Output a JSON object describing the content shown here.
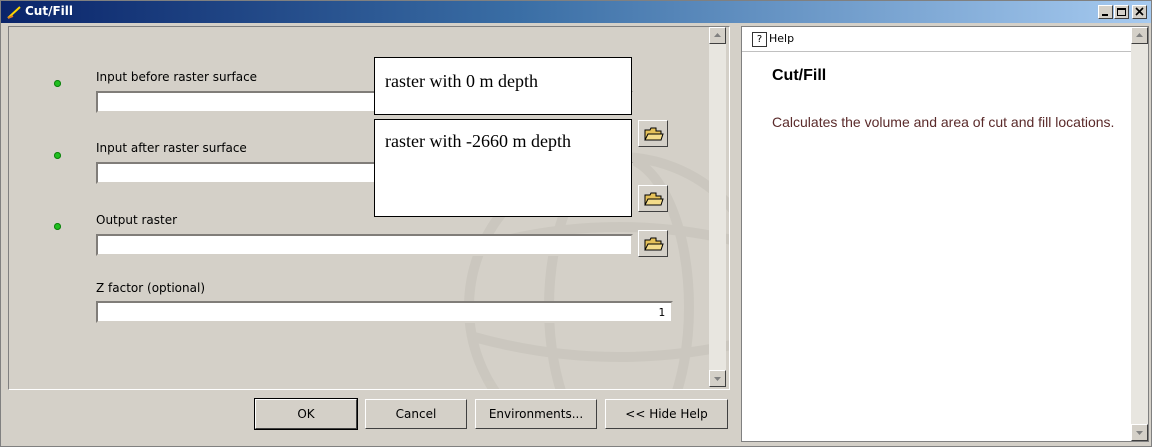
{
  "window": {
    "title": "Cut/Fill"
  },
  "form": {
    "params": [
      {
        "label": "Input before raster surface",
        "value": ""
      },
      {
        "label": "Input after raster surface",
        "value": ""
      },
      {
        "label": "Output raster",
        "value": ""
      },
      {
        "label": "Z factor (optional)",
        "value": "1"
      }
    ]
  },
  "annotations": {
    "before": "raster with 0 m depth",
    "after": "raster with -2660 m depth"
  },
  "buttons": {
    "ok": "OK",
    "cancel": "Cancel",
    "environments": "Environments...",
    "hide_help": "<< Hide Help"
  },
  "help": {
    "header": "Help",
    "title": "Cut/Fill",
    "description": "Calculates the volume and area of cut and fill locations."
  },
  "colors": {
    "required_dot": "#1fbf1f",
    "titlebar": "#0a246a"
  }
}
